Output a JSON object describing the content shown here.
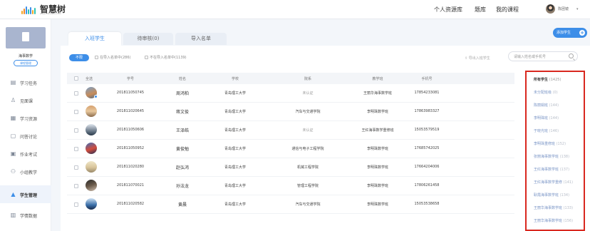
{
  "brand": {
    "name": "智慧树",
    "url": "www.zhihuishu.com"
  },
  "topnav": {
    "items": [
      "个人资源库",
      "题库",
      "我的课程"
    ],
    "user_name": "陈团镜"
  },
  "sidebar": {
    "course_name": "海事数学",
    "course_manage": "课程管理",
    "items": [
      {
        "label": "学习任务",
        "icon": "task-icon"
      },
      {
        "label": "见面课",
        "icon": "meeting-icon"
      },
      {
        "label": "学习资源",
        "icon": "resource-icon"
      },
      {
        "label": "问答讨论",
        "icon": "discussion-icon"
      },
      {
        "label": "作业考试",
        "icon": "exam-icon"
      },
      {
        "label": "小组教学",
        "icon": "group-icon"
      },
      {
        "label": "学生管理",
        "icon": "student-icon",
        "active": true
      },
      {
        "label": "学情数据",
        "icon": "data-icon"
      }
    ]
  },
  "tabs": [
    "入班学生",
    "待审核(0)",
    "导入名单"
  ],
  "add_student": "添加学生",
  "filters": {
    "all": "不限",
    "in_list": "在导入名单中(286)",
    "not_in_list": "不在导入名单中(1139)"
  },
  "export_label": "导出入班学生",
  "search": {
    "placeholder": "请输入姓名或手机号"
  },
  "table": {
    "headers": [
      "全选",
      "学号",
      "姓名",
      "学校",
      "院系",
      "教学班",
      "手机号"
    ],
    "rows": [
      {
        "id": "201811050745",
        "name": "周鸿柏",
        "school": "青岛理工大学",
        "dept": "未认证",
        "cls": "王丽华海事数学班",
        "phone": "17854233081"
      },
      {
        "id": "201811020645",
        "name": "蒋文俊",
        "school": "青岛理工大学",
        "dept": "汽车与交通学院",
        "cls": "李明珠数学班",
        "phone": "17863983327"
      },
      {
        "id": "201811050606",
        "name": "王泽皓",
        "school": "青岛理工大学",
        "dept": "未认证",
        "cls": "王红海事数学重修班",
        "phone": "15053579519"
      },
      {
        "id": "201811050952",
        "name": "黄俊勉",
        "school": "青岛理工大学",
        "dept": "通信与电子工程学院",
        "cls": "李明珠数学班",
        "phone": "17685742025"
      },
      {
        "id": "201811020280",
        "name": "赵弘鸿",
        "school": "青岛理工大学",
        "dept": "机械工程学院",
        "cls": "李明珠数学班",
        "phone": "17664204006"
      },
      {
        "id": "201811070021",
        "name": "孙法龙",
        "school": "青岛理工大学",
        "dept": "管理工程学院",
        "cls": "李明珠数学班",
        "phone": "17806261458"
      },
      {
        "id": "201811020582",
        "name": "黄晨",
        "school": "青岛理工大学",
        "dept": "汽车与交通学院",
        "cls": "李明珠数学班",
        "phone": "15053538658"
      }
    ]
  },
  "groups": [
    {
      "label": "所有学生",
      "count": "(1425)",
      "selected": true
    },
    {
      "label": "未分配班级",
      "count": "(0)"
    },
    {
      "label": "陈丽娟班",
      "count": "(144)"
    },
    {
      "label": "李明珠班",
      "count": "(144)"
    },
    {
      "label": "于晓光班",
      "count": "(146)"
    },
    {
      "label": "李明珠重修班",
      "count": "(152)"
    },
    {
      "label": "张丽海事数学班",
      "count": "(138)"
    },
    {
      "label": "王红海事数学班",
      "count": "(137)"
    },
    {
      "label": "王红海事数学重修",
      "count": "(141)"
    },
    {
      "label": "耿霞海事数学班",
      "count": "(134)"
    },
    {
      "label": "王丽华海事数学班",
      "count": "(133)"
    },
    {
      "label": "王丽华海事数学班",
      "count": "(156)"
    }
  ],
  "colors": {
    "accent": "#3d8ee8",
    "highlight_border": "#d9281f"
  }
}
